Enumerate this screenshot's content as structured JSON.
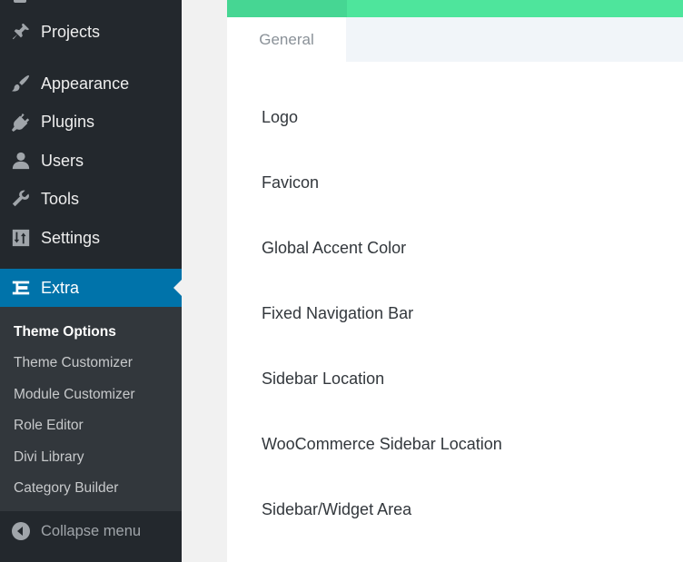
{
  "sidebar": {
    "menu": [
      {
        "label": "Projects",
        "icon": "pin-icon"
      },
      {
        "label": "Appearance",
        "icon": "paintbrush-icon"
      },
      {
        "label": "Plugins",
        "icon": "plug-icon"
      },
      {
        "label": "Users",
        "icon": "user-icon"
      },
      {
        "label": "Tools",
        "icon": "wrench-icon"
      },
      {
        "label": "Settings",
        "icon": "settings-icon"
      },
      {
        "label": "Extra",
        "icon": "extra-icon",
        "active": true
      }
    ],
    "submenu": [
      {
        "label": "Theme Options",
        "current": true
      },
      {
        "label": "Theme Customizer"
      },
      {
        "label": "Module Customizer"
      },
      {
        "label": "Role Editor"
      },
      {
        "label": "Divi Library"
      },
      {
        "label": "Category Builder"
      }
    ],
    "collapse": {
      "label": "Collapse menu",
      "icon": "collapse-arrow-icon"
    }
  },
  "panel": {
    "tabs": [
      {
        "label": "General",
        "active": true
      }
    ],
    "options": [
      "Logo",
      "Favicon",
      "Global Accent Color",
      "Fixed Navigation Bar",
      "Sidebar Location",
      "WooCommerce Sidebar Location",
      "Sidebar/Widget Area"
    ]
  },
  "colors": {
    "sidebar_bg": "#23282d",
    "submenu_bg": "#32373c",
    "active_bg": "#0073aa",
    "accent_green": "#4ee59c",
    "icon_gray": "#a0a5aa"
  }
}
